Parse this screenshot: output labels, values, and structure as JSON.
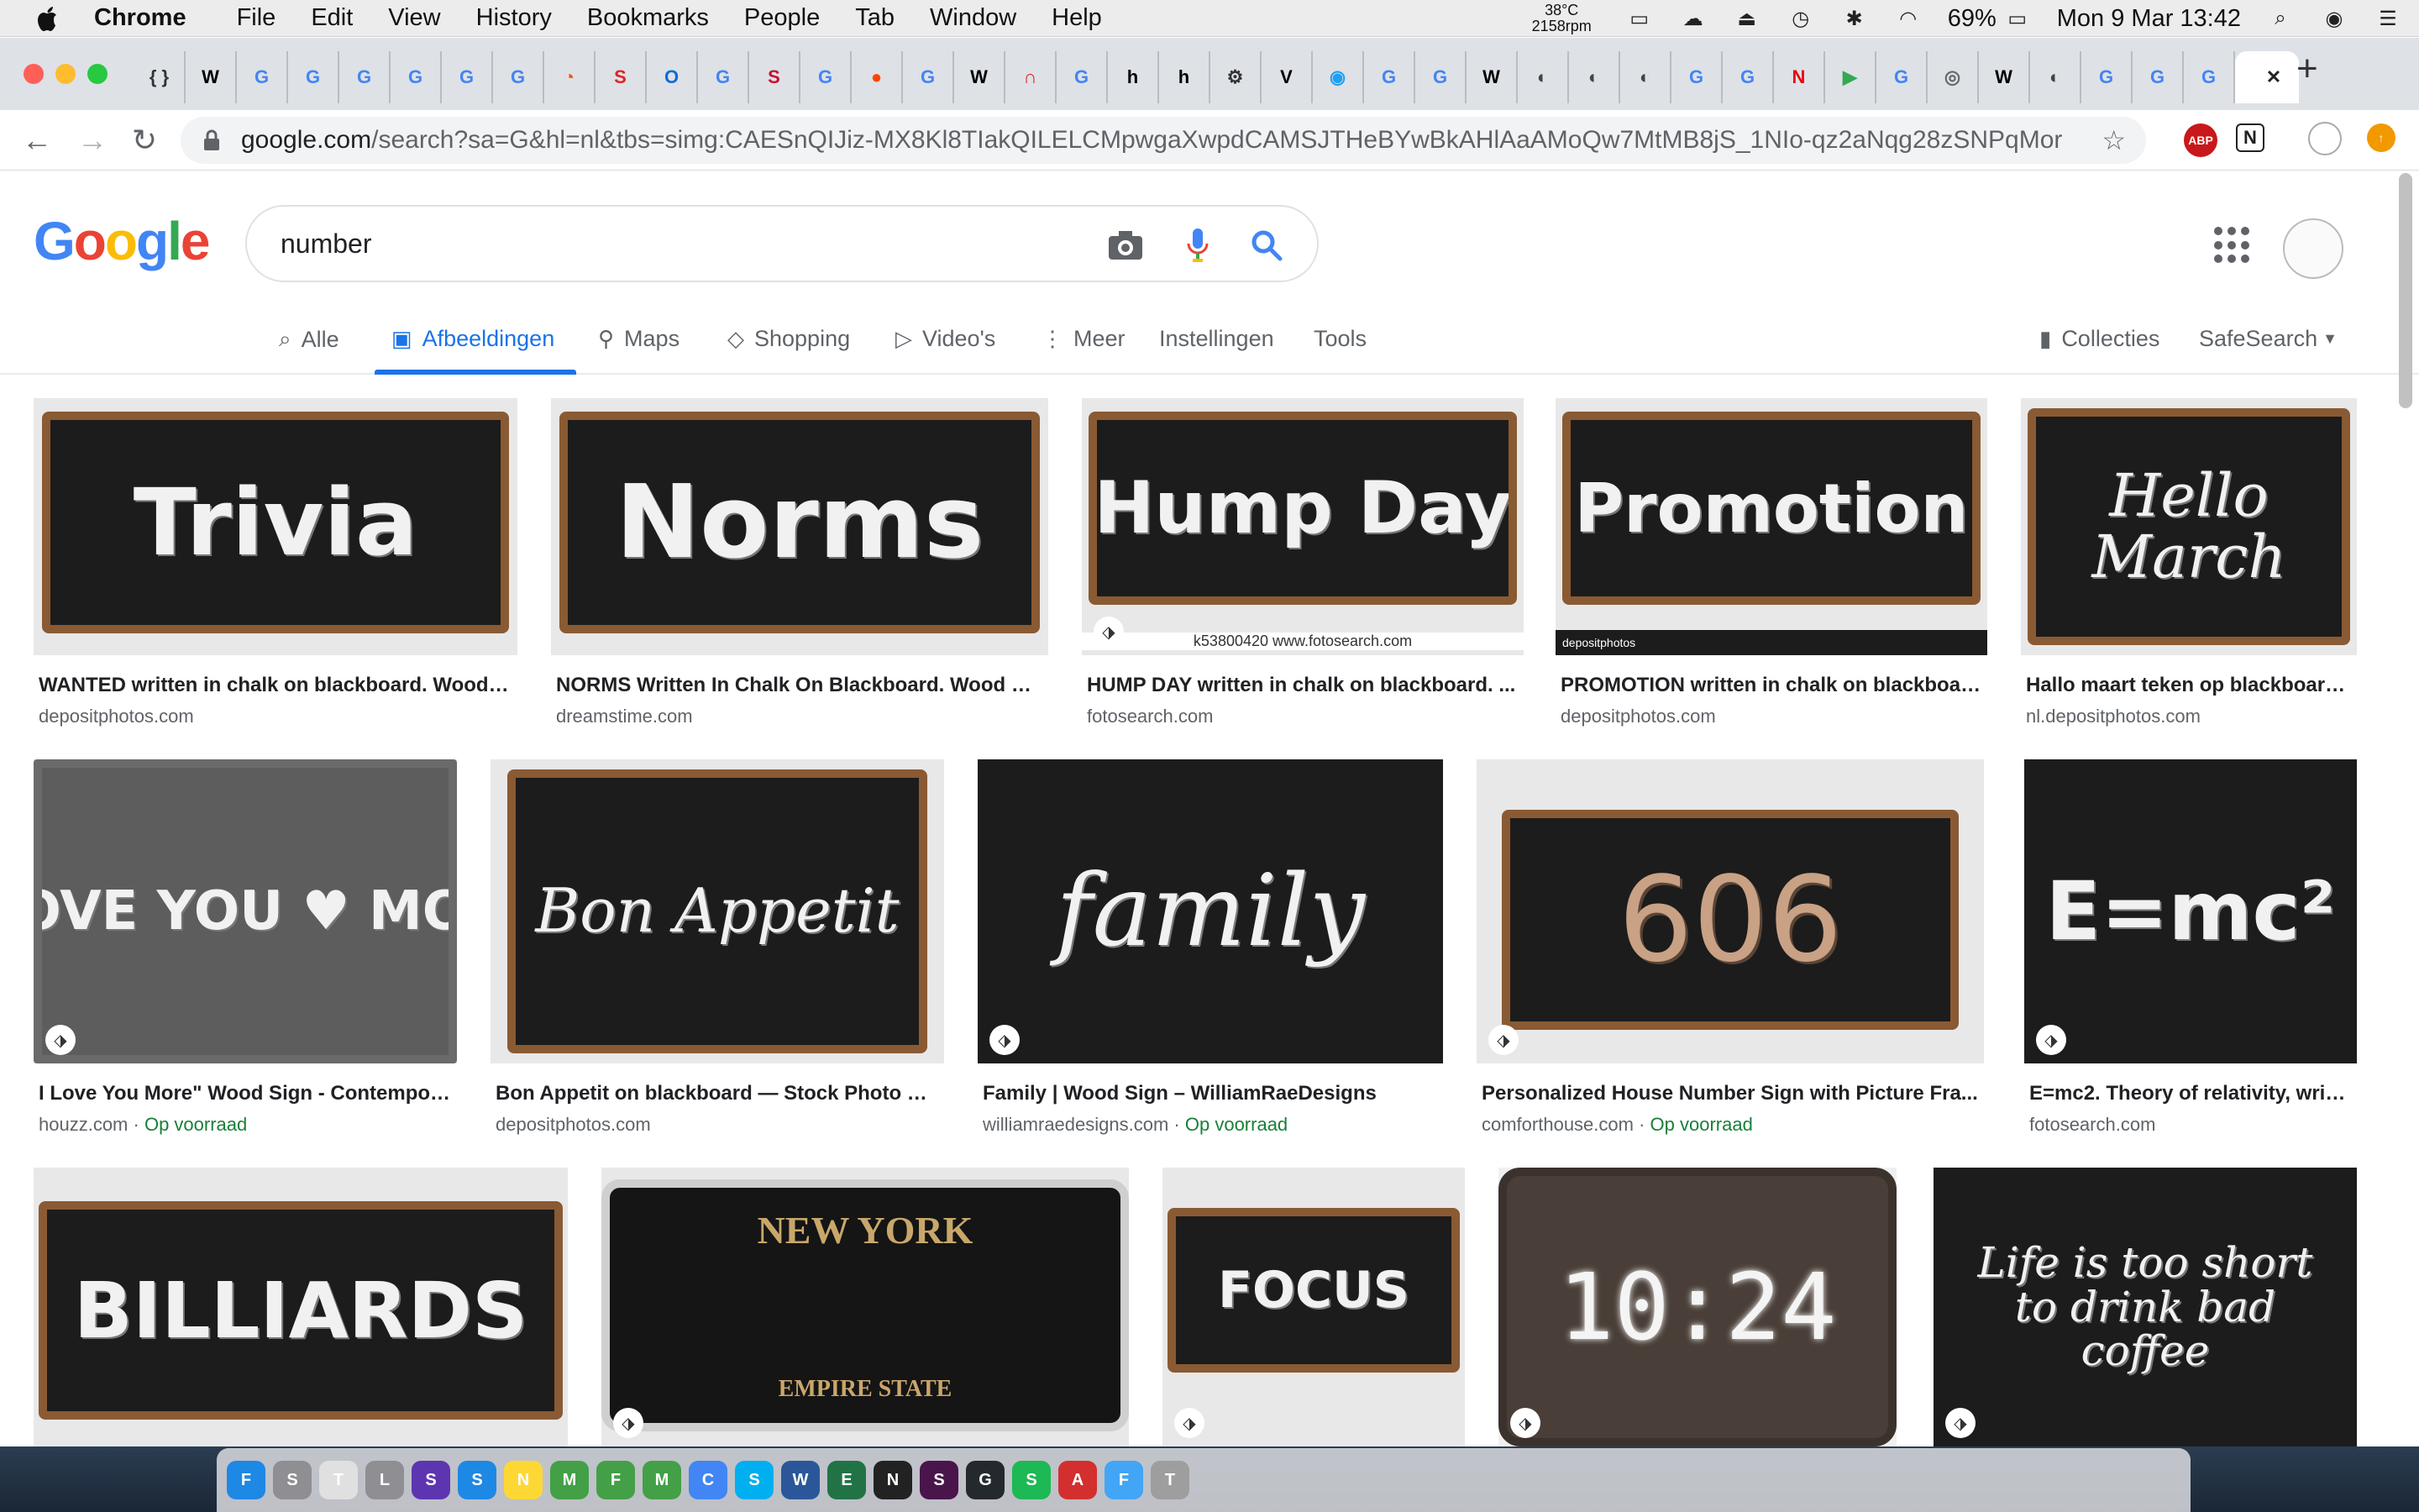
{
  "menubar": {
    "app": "Chrome",
    "items": [
      "File",
      "Edit",
      "View",
      "History",
      "Bookmarks",
      "People",
      "Tab",
      "Window",
      "Help"
    ],
    "temp": "38°C",
    "rpm": "2158rpm",
    "battery": "69%",
    "datetime": "Mon 9 Mar  13:42"
  },
  "browser": {
    "tab_favicons": [
      "{ }",
      "W",
      "G",
      "G",
      "G",
      "G",
      "G",
      "G",
      "◔",
      "S",
      "O",
      "G",
      "S",
      "G",
      "●",
      "G",
      "W",
      "∩",
      "G",
      "h",
      "h",
      "⚙",
      "V",
      "◉",
      "G",
      "G",
      "W",
      "◐",
      "◐",
      "◐",
      "G",
      "G",
      "N",
      "▶",
      "G",
      "◎",
      "W",
      "◐",
      "G",
      "G",
      "G"
    ],
    "active_tab_close": "✕",
    "new_tab": "+",
    "url_host": "google.com",
    "url_path": "/search?sa=G&hl=nl&tbs=simg:CAESnQIJiz-MX8Kl8TIakQILELCMpwgaXwpdCAMSJTHeBYwBkAHlAaAMoQw7MtMB8jS_1NIo-qz2aNqg28zSNPqMorDQa...",
    "extensions": [
      "ABP",
      "N"
    ]
  },
  "google": {
    "logo": "Google",
    "logo_colors": [
      "#4285f4",
      "#ea4335",
      "#fbbc05",
      "#4285f4",
      "#34a853",
      "#ea4335"
    ],
    "query": "number",
    "nav": [
      {
        "label": "Alle",
        "icon": "search-icon"
      },
      {
        "label": "Afbeeldingen",
        "icon": "image-icon"
      },
      {
        "label": "Maps",
        "icon": "map-pin-icon"
      },
      {
        "label": "Shopping",
        "icon": "tag-icon"
      },
      {
        "label": "Video's",
        "icon": "video-icon"
      },
      {
        "label": "Meer",
        "icon": "more-vert-icon"
      },
      {
        "label": "Instellingen"
      },
      {
        "label": "Tools"
      }
    ],
    "collections": "Collecties",
    "safesearch": "SafeSearch"
  },
  "results": [
    {
      "board_text": "Trivia",
      "title": "WANTED written in chalk on blackboard. Wood fr...",
      "source": "depositphotos.com"
    },
    {
      "board_text": "Norms",
      "title": "NORMS Written In Chalk On Blackboard. Wood Fr...",
      "source": "dreamstime.com"
    },
    {
      "board_text": "Hump Day",
      "title": "HUMP DAY written in chalk on blackboard. ...",
      "source": "fotosearch.com",
      "watermark": "k53800420  www.fotosearch.com"
    },
    {
      "board_text": "Promotion",
      "title": "PROMOTION written in chalk on blackboar...",
      "source": "depositphotos.com",
      "watermark": "depositphotos"
    },
    {
      "board_text": "Hello March",
      "title": "Hallo maart teken op blackboard ...",
      "source": "nl.depositphotos.com"
    },
    {
      "board_text": "I LOVE YOU ♥ MORE",
      "title": "I Love You More\" Wood Sign - Contempora...",
      "source": "houzz.com",
      "stock": "Op voorraad"
    },
    {
      "board_text": "Bon Appetit",
      "title": "Bon Appetit on blackboard — Stock Photo © ...",
      "source": "depositphotos.com"
    },
    {
      "board_text": "family",
      "title": "Family | Wood Sign – WilliamRaeDesigns",
      "source": "williamraedesigns.com",
      "stock": "Op voorraad"
    },
    {
      "board_text": "606",
      "title": "Personalized House Number Sign with Picture Fra...",
      "source": "comforthouse.com",
      "stock": "Op voorraad"
    },
    {
      "board_text": "E=mc²",
      "title": "E=mc2. Theory of relativity, writin...",
      "source": "fotosearch.com"
    },
    {
      "board_text": "BILLIARDS"
    },
    {
      "board_text": "NEW YORK",
      "sub_text": "EMPIRE STATE"
    },
    {
      "board_text": "FOCUS"
    },
    {
      "board_text": "10:24"
    },
    {
      "board_text": "Life is too short to drink bad coffee"
    }
  ],
  "dock_apps": [
    "Finder",
    "Settings",
    "TextEdit",
    "Launchpad",
    "Siri",
    "Safari",
    "Notes",
    "Messages",
    "FaceTime",
    "Maps",
    "Chrome",
    "Skype",
    "Word",
    "Excel",
    "Notion",
    "Slack",
    "GitHub",
    "Spotify",
    "Acrobat",
    "Folder",
    "Trash"
  ],
  "colors": {
    "accent": "#1a73e8",
    "stock_green": "#188038",
    "board": "#1c1c1c",
    "frame": "#8a5a33"
  }
}
